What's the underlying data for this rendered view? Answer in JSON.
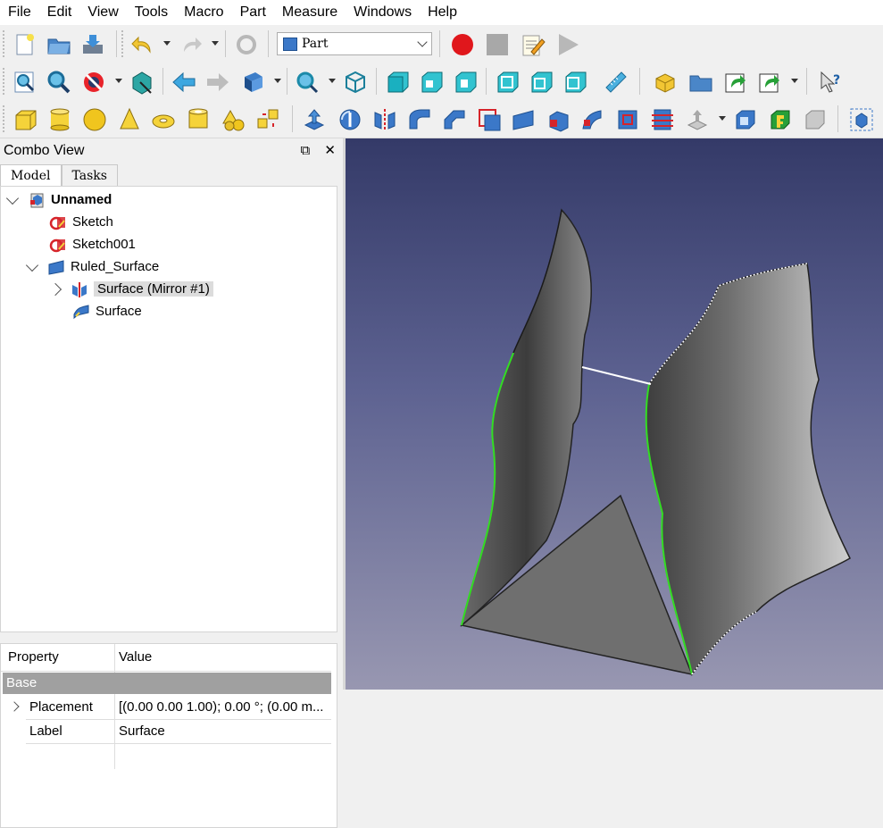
{
  "menubar": [
    "File",
    "Edit",
    "View",
    "Tools",
    "Macro",
    "Part",
    "Measure",
    "Windows",
    "Help"
  ],
  "workbench": {
    "selected": "Part"
  },
  "combo_view": {
    "title": "Combo View",
    "tabs": [
      "Model",
      "Tasks"
    ],
    "tree": {
      "root": "Unnamed",
      "items": [
        {
          "label": "Sketch"
        },
        {
          "label": "Sketch001"
        },
        {
          "label": "Ruled_Surface"
        },
        {
          "label": "Surface (Mirror #1)"
        },
        {
          "label": "Surface"
        }
      ]
    }
  },
  "properties": {
    "headers": [
      "Property",
      "Value"
    ],
    "group": "Base",
    "rows": [
      {
        "name": "Placement",
        "value": "[(0.00 0.00 1.00); 0.00 °; (0.00 m..."
      },
      {
        "name": "Label",
        "value": "Surface"
      }
    ]
  },
  "colors": {
    "highlight": "#f47c30",
    "selection_edge": "#33dd22",
    "viewport_top": "#343a68",
    "viewport_bottom": "#9897b1"
  },
  "icons": {
    "toolbar1": [
      "new-document-icon",
      "open-icon",
      "save-icon",
      "undo-icon",
      "redo-icon",
      "refresh-icon",
      "record-macro-icon",
      "stop-macro-icon",
      "edit-macro-icon",
      "run-macro-icon"
    ],
    "toolbar2": [
      "fit-all-icon",
      "fit-selection-icon",
      "draw-style-icon",
      "bounding-box-icon",
      "back-icon",
      "forward-icon",
      "sync-view-icon",
      "std-views-icon",
      "isometric-icon",
      "front-view-icon",
      "top-view-icon",
      "right-view-icon",
      "rear-view-icon",
      "bottom-view-icon",
      "left-view-icon",
      "measure-distance-icon",
      "part-icon",
      "group-icon",
      "link-icon",
      "link-actions-icon",
      "whats-this-icon"
    ],
    "toolbar3": [
      "box-icon",
      "cylinder-icon",
      "sphere-icon",
      "cone-icon",
      "torus-icon",
      "tube-icon",
      "primitives-icon",
      "shape-builder-icon",
      "extrude-icon",
      "revolve-icon",
      "mirror-icon",
      "fillet-icon",
      "chamfer-icon",
      "make-face-icon",
      "ruled-surface-icon",
      "loft-icon",
      "sweep-icon",
      "section-icon",
      "cross-sections-icon",
      "offset-icon",
      "thickness-icon",
      "projection-icon",
      "color-per-face-icon",
      "refine-shape-icon",
      "box-selection-icon"
    ]
  }
}
